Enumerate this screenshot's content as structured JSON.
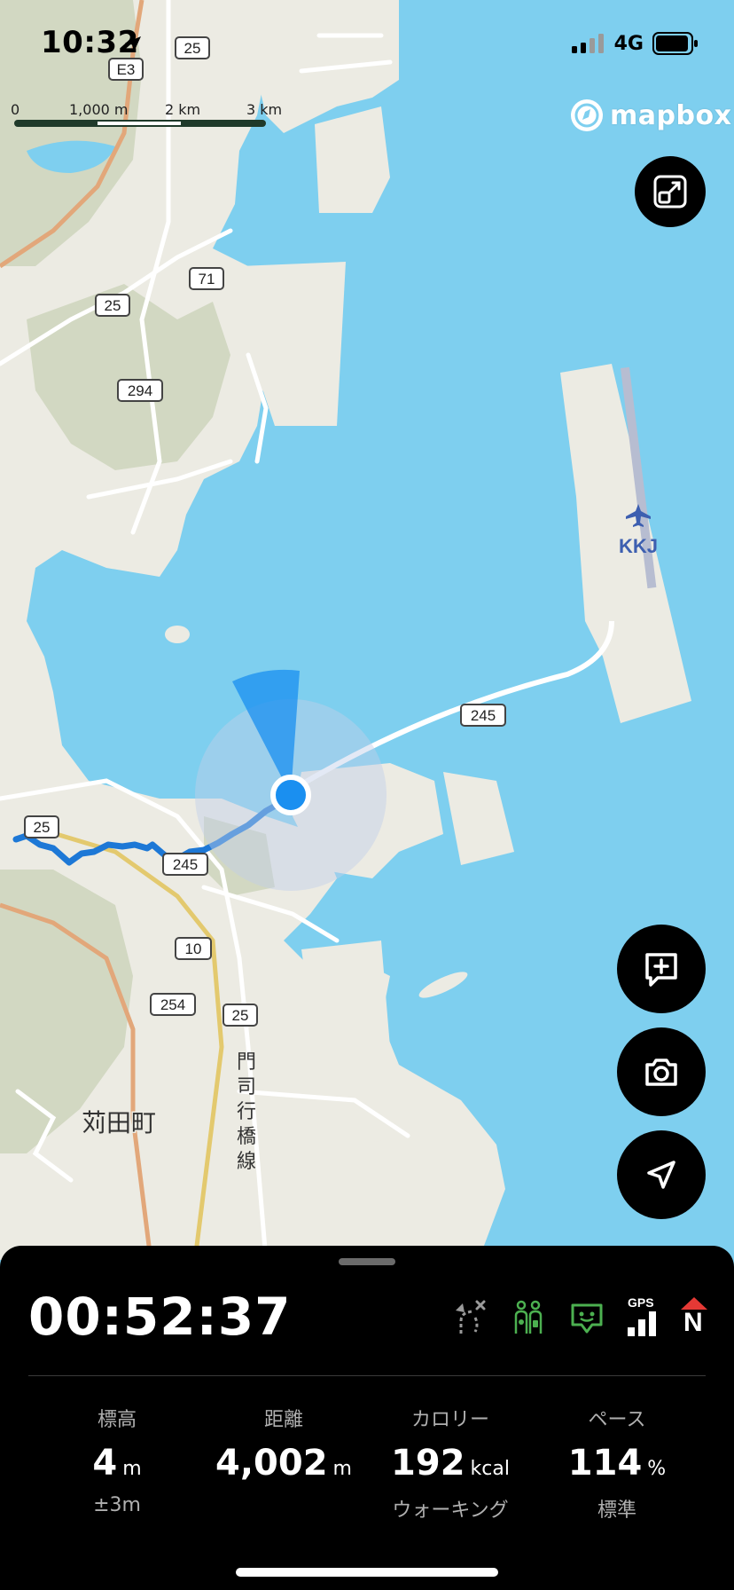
{
  "status_bar": {
    "time": "10:32",
    "network": "4G"
  },
  "map": {
    "scale_labels": [
      "0",
      "1,000 m",
      "2 km",
      "3 km"
    ],
    "attribution": "mapbox",
    "place_label": "苅田町",
    "airport_code": "KKJ",
    "line_label": "門司行橋線",
    "road_shields": [
      "25",
      "E3",
      "25",
      "71",
      "294",
      "245",
      "25",
      "245",
      "10",
      "254",
      "25"
    ]
  },
  "controls": {
    "fit_icon": "fit-to-route-icon",
    "memo_icon": "add-memo-icon",
    "camera_icon": "camera-icon",
    "locate_icon": "locate-arrow-icon"
  },
  "panel": {
    "elapsed": "00:52:37",
    "status_icons": [
      "route-off-icon",
      "group-icon",
      "chat-icon",
      "gps-signal-icon",
      "north-compass-icon"
    ],
    "gps_label": "GPS",
    "north_label": "N",
    "stats": [
      {
        "label": "標高",
        "value": "4",
        "unit": "m",
        "sub": "±3m"
      },
      {
        "label": "距離",
        "value": "4,002",
        "unit": "m",
        "sub": ""
      },
      {
        "label": "カロリー",
        "value": "192",
        "unit": "kcal",
        "sub": "ウォーキング"
      },
      {
        "label": "ペース",
        "value": "114",
        "unit": "%",
        "sub": "標準"
      }
    ]
  },
  "colors": {
    "water": "#7ecfef",
    "land": "#ecebe3",
    "terrain": "#d2d8c2",
    "track": "#1d78d6",
    "location": "#1a8ff0",
    "panel_bg": "#000000",
    "accent_green": "#4cb050",
    "compass_red": "#e53935"
  }
}
